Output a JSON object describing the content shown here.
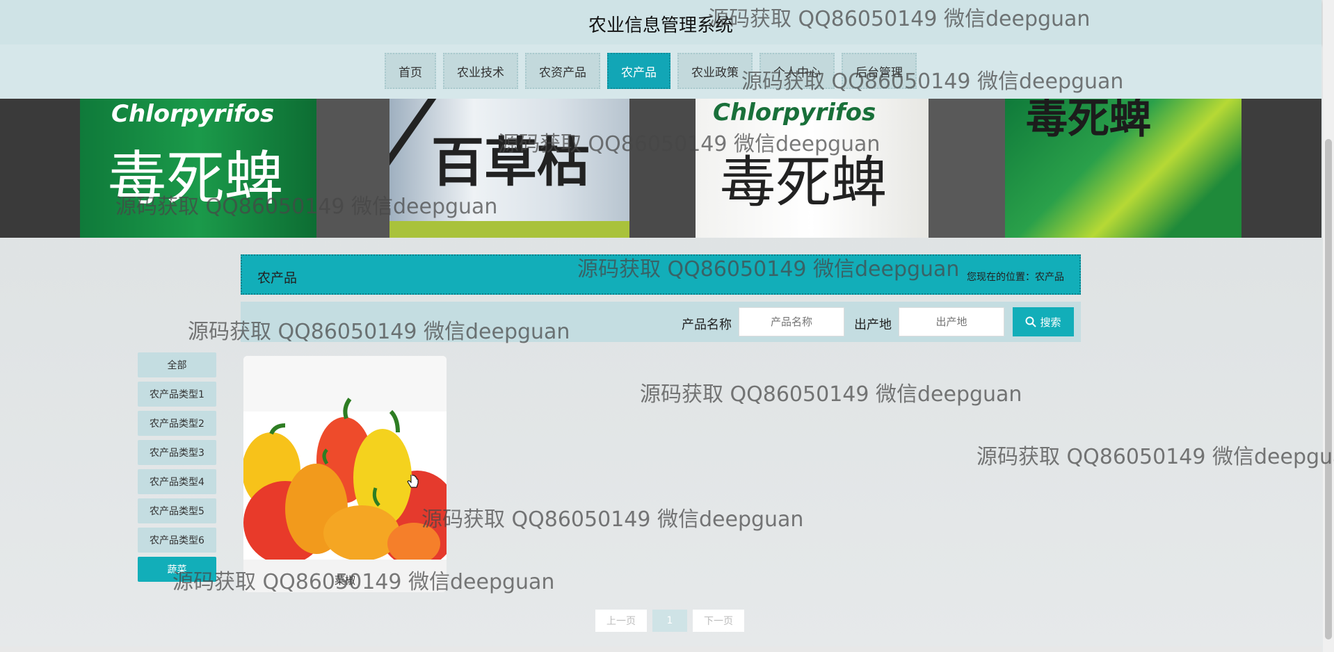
{
  "header": {
    "title": "农业信息管理系统"
  },
  "nav": {
    "items": [
      {
        "label": "首页"
      },
      {
        "label": "农业技术"
      },
      {
        "label": "农资产品"
      },
      {
        "label": "农产品",
        "active": true
      },
      {
        "label": "农业政策"
      },
      {
        "label": "个人中心"
      },
      {
        "label": "后台管理"
      }
    ]
  },
  "banner": {
    "texts": [
      "Chlorpyrifos",
      "毒死蜱",
      "百草枯",
      "Chlorpyrifos",
      "毒死蜱",
      "毒死蜱"
    ]
  },
  "section": {
    "title": "农产品",
    "location": "您现在的位置：农产品"
  },
  "search": {
    "name_label": "产品名称",
    "name_placeholder": "产品名称",
    "origin_label": "出产地",
    "origin_placeholder": "出产地",
    "button_label": "搜索"
  },
  "categories": [
    {
      "label": "全部"
    },
    {
      "label": "农产品类型1"
    },
    {
      "label": "农产品类型2"
    },
    {
      "label": "农产品类型3"
    },
    {
      "label": "农产品类型4"
    },
    {
      "label": "农产品类型5"
    },
    {
      "label": "农产品类型6"
    },
    {
      "label": "蔬菜",
      "active": true
    }
  ],
  "products": [
    {
      "name": "菜椒"
    }
  ],
  "pagination": {
    "prev": "上一页",
    "current": "1",
    "next": "下一页"
  },
  "watermark": "源码获取 QQ86050149 微信deepguan",
  "colors": {
    "accent": "#12aeb9",
    "header_bg": "#cfe3e6"
  }
}
